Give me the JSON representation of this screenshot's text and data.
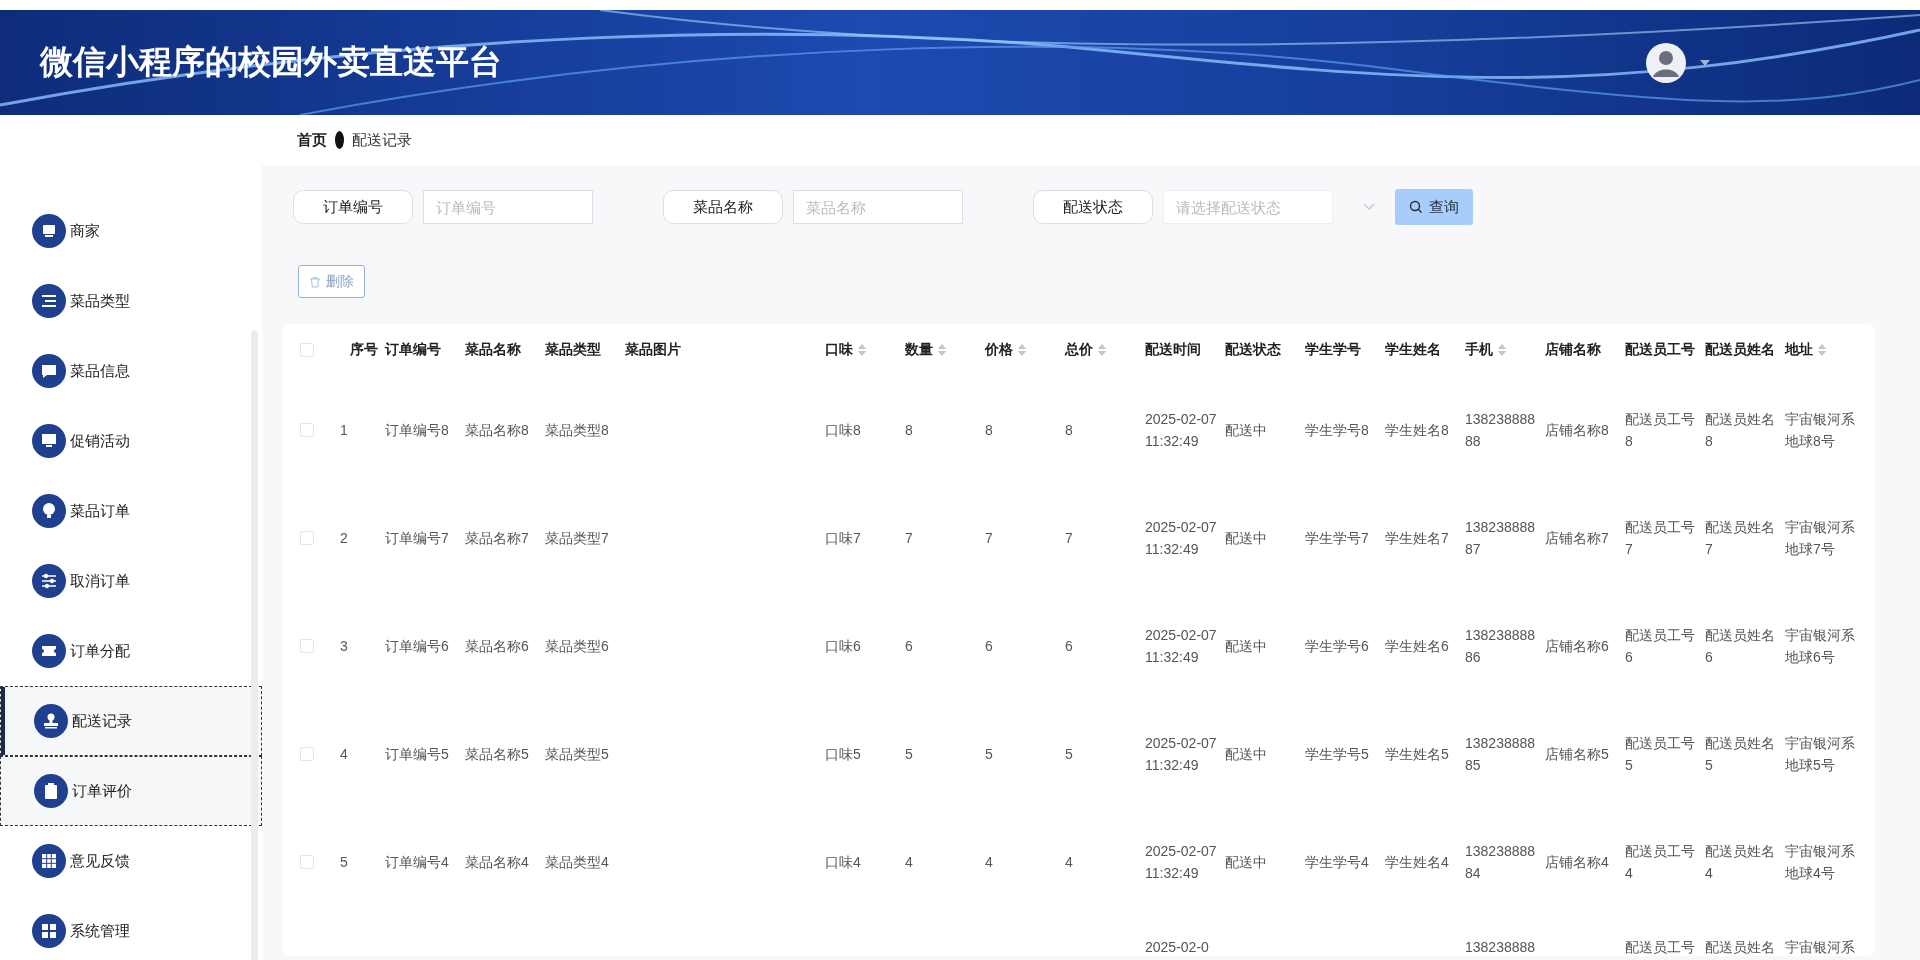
{
  "header": {
    "title": "微信小程序的校园外卖直送平台"
  },
  "breadcrumb": [
    "首页",
    "配送记录"
  ],
  "sidebar": {
    "items": [
      {
        "label": "商家",
        "selected": false,
        "focused": false
      },
      {
        "label": "菜品类型",
        "selected": false,
        "focused": false
      },
      {
        "label": "菜品信息",
        "selected": false,
        "focused": false
      },
      {
        "label": "促销活动",
        "selected": false,
        "focused": false
      },
      {
        "label": "菜品订单",
        "selected": false,
        "focused": false
      },
      {
        "label": "取消订单",
        "selected": false,
        "focused": false
      },
      {
        "label": "订单分配",
        "selected": false,
        "focused": false
      },
      {
        "label": "配送记录",
        "selected": true,
        "focused": true
      },
      {
        "label": "订单评价",
        "selected": false,
        "focused": true
      },
      {
        "label": "意见反馈",
        "selected": false,
        "focused": false
      },
      {
        "label": "系统管理",
        "selected": false,
        "focused": false
      }
    ]
  },
  "filters": [
    {
      "label": "订单编号",
      "kind": "input",
      "placeholder": "订单编号"
    },
    {
      "label": "菜品名称",
      "kind": "input",
      "placeholder": "菜品名称"
    },
    {
      "label": "配送状态",
      "kind": "select",
      "placeholder": "请选择配送状态"
    }
  ],
  "search_button": "查询",
  "delete_button": "删除",
  "table": {
    "select_all_checked": false,
    "columns": [
      {
        "label": "序号",
        "sortable": false
      },
      {
        "label": "订单编号",
        "sortable": false
      },
      {
        "label": "菜品名称",
        "sortable": false
      },
      {
        "label": "菜品类型",
        "sortable": false
      },
      {
        "label": "菜品图片",
        "sortable": false
      },
      {
        "label": "口味",
        "sortable": true
      },
      {
        "label": "数量",
        "sortable": true
      },
      {
        "label": "价格",
        "sortable": true
      },
      {
        "label": "总价",
        "sortable": true
      },
      {
        "label": "配送时间",
        "sortable": false
      },
      {
        "label": "配送状态",
        "sortable": false
      },
      {
        "label": "学生学号",
        "sortable": false
      },
      {
        "label": "学生姓名",
        "sortable": false
      },
      {
        "label": "手机",
        "sortable": true
      },
      {
        "label": "店铺名称",
        "sortable": false
      },
      {
        "label": "配送员工号",
        "sortable": false
      },
      {
        "label": "配送员姓名",
        "sortable": false
      },
      {
        "label": "地址",
        "sortable": true
      }
    ],
    "rows": [
      {
        "checked": false,
        "cells": [
          "1",
          "订单编号8",
          "菜品名称8",
          "菜品类型8",
          null,
          "口味8",
          "8",
          "8",
          "8",
          "2025-02-07 11:32:49",
          "配送中",
          "学生学号8",
          "学生姓名8",
          "13823888888",
          "店铺名称8",
          "配送员工号8",
          "配送员姓名8",
          "宇宙银河系地球8号"
        ]
      },
      {
        "checked": false,
        "cells": [
          "2",
          "订单编号7",
          "菜品名称7",
          "菜品类型7",
          null,
          "口味7",
          "7",
          "7",
          "7",
          "2025-02-07 11:32:49",
          "配送中",
          "学生学号7",
          "学生姓名7",
          "13823888887",
          "店铺名称7",
          "配送员工号7",
          "配送员姓名7",
          "宇宙银河系地球7号"
        ]
      },
      {
        "checked": false,
        "cells": [
          "3",
          "订单编号6",
          "菜品名称6",
          "菜品类型6",
          null,
          "口味6",
          "6",
          "6",
          "6",
          "2025-02-07 11:32:49",
          "配送中",
          "学生学号6",
          "学生姓名6",
          "13823888886",
          "店铺名称6",
          "配送员工号6",
          "配送员姓名6",
          "宇宙银河系地球6号"
        ]
      },
      {
        "checked": false,
        "cells": [
          "4",
          "订单编号5",
          "菜品名称5",
          "菜品类型5",
          null,
          "口味5",
          "5",
          "5",
          "5",
          "2025-02-07 11:32:49",
          "配送中",
          "学生学号5",
          "学生姓名5",
          "13823888885",
          "店铺名称5",
          "配送员工号5",
          "配送员姓名5",
          "宇宙银河系地球5号"
        ]
      },
      {
        "checked": false,
        "cells": [
          "5",
          "订单编号4",
          "菜品名称4",
          "菜品类型4",
          null,
          "口味4",
          "4",
          "4",
          "4",
          "2025-02-07 11:32:49",
          "配送中",
          "学生学号4",
          "学生姓名4",
          "13823888884",
          "店铺名称4",
          "配送员工号4",
          "配送员姓名4",
          "宇宙银河系地球4号"
        ]
      }
    ],
    "partial_row": {
      "cells": [
        null,
        null,
        null,
        null,
        null,
        null,
        null,
        null,
        null,
        "2025-02-0",
        null,
        null,
        null,
        "138238888",
        null,
        "配送员工号",
        "配送员姓名",
        "宇宙银河系"
      ]
    }
  }
}
